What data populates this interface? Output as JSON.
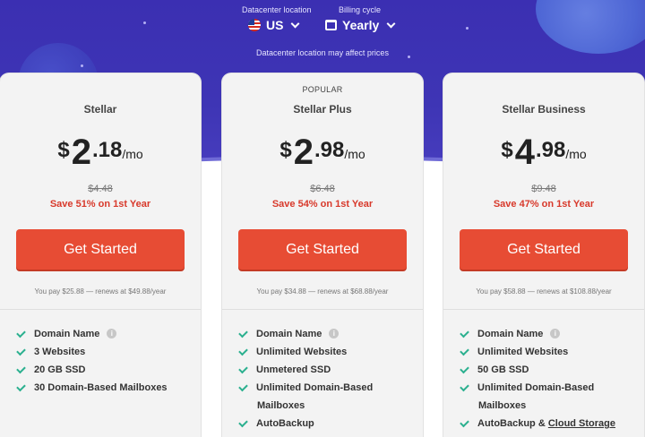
{
  "header": {
    "datacenter_label": "Datacenter location",
    "datacenter_value": "US",
    "billing_label": "Billing cycle",
    "billing_value": "Yearly",
    "note": "Datacenter location may affect prices"
  },
  "plans": [
    {
      "popular": "",
      "name": "Stellar",
      "currency": "$",
      "price_int": "2",
      "price_dec": ".18",
      "per": "/mo",
      "old_price": "$4.48",
      "save": "Save 51% on 1st Year",
      "cta": "Get Started",
      "renew": "You pay $25.88 — renews at $49.88/year",
      "features": [
        "Domain Name",
        "3 Websites",
        "20 GB SSD",
        "30 Domain-Based Mailboxes"
      ]
    },
    {
      "popular": "POPULAR",
      "name": "Stellar Plus",
      "currency": "$",
      "price_int": "2",
      "price_dec": ".98",
      "per": "/mo",
      "old_price": "$6.48",
      "save": "Save 54% on 1st Year",
      "cta": "Get Started",
      "renew": "You pay $34.88 — renews at $68.88/year",
      "features": [
        "Domain Name",
        "Unlimited Websites",
        "Unmetered SSD",
        "Unlimited Domain-Based",
        "Mailboxes",
        "AutoBackup"
      ]
    },
    {
      "popular": "",
      "name": "Stellar Business",
      "currency": "$",
      "price_int": "4",
      "price_dec": ".98",
      "per": "/mo",
      "old_price": "$9.48",
      "save": "Save 47% on 1st Year",
      "cta": "Get Started",
      "renew": "You pay $58.88 — renews at $108.88/year",
      "features": [
        "Domain Name",
        "Unlimited Websites",
        "50 GB SSD",
        "Unlimited Domain-Based",
        "Mailboxes",
        "AutoBackup & ",
        "Cloud Storage"
      ]
    }
  ],
  "colors": {
    "accent": "#e74c34",
    "save_text": "#d8392b",
    "check": "#2bb08f",
    "sky": "#3b2fb2"
  },
  "icons": {
    "flag": "us-flag-icon",
    "calendar": "calendar-icon",
    "chevron": "chevron-down-icon",
    "check": "check-icon",
    "info": "info-icon"
  }
}
